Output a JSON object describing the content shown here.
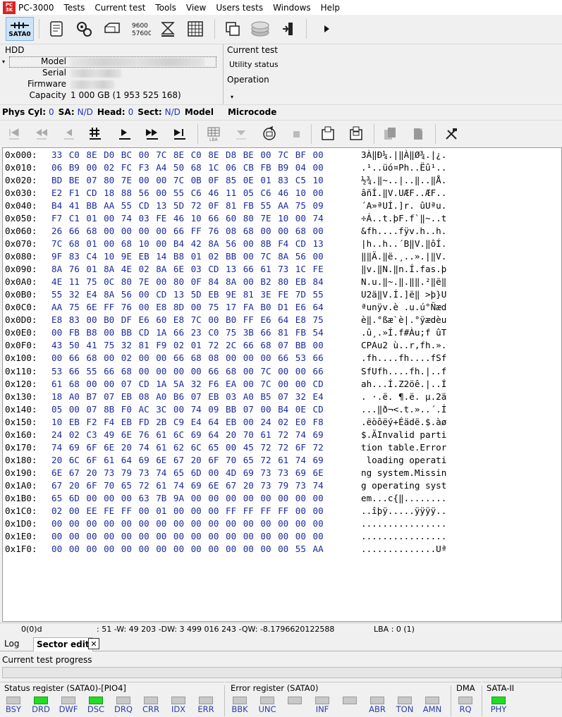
{
  "title": "PC-3000",
  "menu": [
    "Tests",
    "Current test",
    "Tools",
    "View",
    "Users tests",
    "Windows",
    "Help"
  ],
  "toolbar": {
    "sata_label": "SATA0",
    "cnt_top": "9600",
    "cnt_bottom": "57600"
  },
  "hdd": {
    "title": "HDD",
    "model_label": "Model",
    "serial_label": "Serial",
    "firmware_label": "Firmware",
    "capacity_label": "Capacity",
    "capacity": "1 000 GB (1 953 525 168)"
  },
  "current_test": {
    "label": "Current test",
    "value": "Utility status",
    "operation_label": "Operation"
  },
  "infobar": {
    "phys_cyl_label": "Phys Cyl:",
    "phys_cyl": "0",
    "sa_label": "SA:",
    "sa": "N/D",
    "head_label": "Head:",
    "head": "0",
    "sect_label": "Sect:",
    "sect": "N/D",
    "model_label": "Model",
    "microcode_label": "Microcode"
  },
  "hex_rows": [
    {
      "off": "0x000:",
      "bytes": [
        "33",
        "C0",
        "8E",
        "D0",
        "BC",
        "00",
        "7C",
        "8E",
        "C0",
        "8E",
        "D8",
        "BE",
        "00",
        "7C",
        "BF",
        "00"
      ],
      "ascii": "3À‖Ð¼.|‖À‖Ø¾.|¿."
    },
    {
      "off": "0x010:",
      "bytes": [
        "06",
        "B9",
        "00",
        "02",
        "FC",
        "F3",
        "A4",
        "50",
        "68",
        "1C",
        "06",
        "CB",
        "FB",
        "B9",
        "04",
        "00"
      ],
      "ascii": ".¹..üó¤Ph..Ëû¹.."
    },
    {
      "off": "0x020:",
      "bytes": [
        "BD",
        "BE",
        "07",
        "80",
        "7E",
        "00",
        "00",
        "7C",
        "0B",
        "0F",
        "85",
        "0E",
        "01",
        "83",
        "C5",
        "10"
      ],
      "ascii": "½¾.‖~..|..‖..‖Å."
    },
    {
      "off": "0x030:",
      "bytes": [
        "E2",
        "F1",
        "CD",
        "18",
        "88",
        "56",
        "00",
        "55",
        "C6",
        "46",
        "11",
        "05",
        "C6",
        "46",
        "10",
        "00"
      ],
      "ascii": "âñÍ.‖V.UÆF..ÆF.."
    },
    {
      "off": "0x040:",
      "bytes": [
        "B4",
        "41",
        "BB",
        "AA",
        "55",
        "CD",
        "13",
        "5D",
        "72",
        "0F",
        "81",
        "FB",
        "55",
        "AA",
        "75",
        "09"
      ],
      "ascii": "´A»ªUÍ.]r. ûUªu."
    },
    {
      "off": "0x050:",
      "bytes": [
        "F7",
        "C1",
        "01",
        "00",
        "74",
        "03",
        "FE",
        "46",
        "10",
        "66",
        "60",
        "80",
        "7E",
        "10",
        "00",
        "74"
      ],
      "ascii": "÷Á..t.þF.f`‖~..t"
    },
    {
      "off": "0x060:",
      "bytes": [
        "26",
        "66",
        "68",
        "00",
        "00",
        "00",
        "00",
        "66",
        "FF",
        "76",
        "08",
        "68",
        "00",
        "00",
        "68",
        "00"
      ],
      "ascii": "&fh....fÿv.h..h."
    },
    {
      "off": "0x070:",
      "bytes": [
        "7C",
        "68",
        "01",
        "00",
        "68",
        "10",
        "00",
        "B4",
        "42",
        "8A",
        "56",
        "00",
        "8B",
        "F4",
        "CD",
        "13"
      ],
      "ascii": "|h..h..´B‖V.‖ôÍ."
    },
    {
      "off": "0x080:",
      "bytes": [
        "9F",
        "83",
        "C4",
        "10",
        "9E",
        "EB",
        "14",
        "B8",
        "01",
        "02",
        "BB",
        "00",
        "7C",
        "8A",
        "56",
        "00"
      ],
      "ascii": "‖‖Ä.‖ë.¸..».|‖V."
    },
    {
      "off": "0x090:",
      "bytes": [
        "8A",
        "76",
        "01",
        "8A",
        "4E",
        "02",
        "8A",
        "6E",
        "03",
        "CD",
        "13",
        "66",
        "61",
        "73",
        "1C",
        "FE"
      ],
      "ascii": "‖v.‖N.‖n.Í.fas.þ"
    },
    {
      "off": "0x0A0:",
      "bytes": [
        "4E",
        "11",
        "75",
        "0C",
        "80",
        "7E",
        "00",
        "80",
        "0F",
        "84",
        "8A",
        "00",
        "B2",
        "80",
        "EB",
        "84"
      ],
      "ascii": "N.u.‖~.‖.‖‖.²‖ë‖"
    },
    {
      "off": "0x0B0:",
      "bytes": [
        "55",
        "32",
        "E4",
        "8A",
        "56",
        "00",
        "CD",
        "13",
        "5D",
        "EB",
        "9E",
        "81",
        "3E",
        "FE",
        "7D",
        "55"
      ],
      "ascii": "U2ä‖V.Í.]ë‖ >þ}U"
    },
    {
      "off": "0x0C0:",
      "bytes": [
        "AA",
        "75",
        "6E",
        "FF",
        "76",
        "00",
        "E8",
        "8D",
        "00",
        "75",
        "17",
        "FA",
        "B0",
        "D1",
        "E6",
        "64"
      ],
      "ascii": "ªunÿv.è .u.ú°Ñæd"
    },
    {
      "off": "0x0D0:",
      "bytes": [
        "E8",
        "83",
        "00",
        "B0",
        "DF",
        "E6",
        "60",
        "E8",
        "7C",
        "00",
        "B0",
        "FF",
        "E6",
        "64",
        "E8",
        "75"
      ],
      "ascii": "è‖.°ßæ`è|.°ÿædèu"
    },
    {
      "off": "0x0E0:",
      "bytes": [
        "00",
        "FB",
        "B8",
        "00",
        "BB",
        "CD",
        "1A",
        "66",
        "23",
        "C0",
        "75",
        "3B",
        "66",
        "81",
        "FB",
        "54"
      ],
      "ascii": ".û¸.»Í.f#Àu;f ûT"
    },
    {
      "off": "0x0F0:",
      "bytes": [
        "43",
        "50",
        "41",
        "75",
        "32",
        "81",
        "F9",
        "02",
        "01",
        "72",
        "2C",
        "66",
        "68",
        "07",
        "BB",
        "00"
      ],
      "ascii": "CPAu2 ù..r,fh.»."
    },
    {
      "off": "0x100:",
      "bytes": [
        "00",
        "66",
        "68",
        "00",
        "02",
        "00",
        "00",
        "66",
        "68",
        "08",
        "00",
        "00",
        "00",
        "66",
        "53",
        "66"
      ],
      "ascii": ".fh....fh....fSf"
    },
    {
      "off": "0x110:",
      "bytes": [
        "53",
        "66",
        "55",
        "66",
        "68",
        "00",
        "00",
        "00",
        "00",
        "66",
        "68",
        "00",
        "7C",
        "00",
        "00",
        "66"
      ],
      "ascii": "SfUfh....fh.|..f"
    },
    {
      "off": "0x120:",
      "bytes": [
        "61",
        "68",
        "00",
        "00",
        "07",
        "CD",
        "1A",
        "5A",
        "32",
        "F6",
        "EA",
        "00",
        "7C",
        "00",
        "00",
        "CD"
      ],
      "ascii": "ah...Í.Z2öê.|..Í"
    },
    {
      "off": "0x130:",
      "bytes": [
        "18",
        "A0",
        "B7",
        "07",
        "EB",
        "08",
        "A0",
        "B6",
        "07",
        "EB",
        "03",
        "A0",
        "B5",
        "07",
        "32",
        "E4"
      ],
      "ascii": ". ·.ë. ¶.ë. µ.2ä"
    },
    {
      "off": "0x140:",
      "bytes": [
        "05",
        "00",
        "07",
        "8B",
        "F0",
        "AC",
        "3C",
        "00",
        "74",
        "09",
        "BB",
        "07",
        "00",
        "B4",
        "0E",
        "CD"
      ],
      "ascii": "...‖ð¬<.t.»..´.Í"
    },
    {
      "off": "0x150:",
      "bytes": [
        "10",
        "EB",
        "F2",
        "F4",
        "EB",
        "FD",
        "2B",
        "C9",
        "E4",
        "64",
        "EB",
        "00",
        "24",
        "02",
        "E0",
        "F8"
      ],
      "ascii": ".ëòôëý+Éädë.$.àø"
    },
    {
      "off": "0x160:",
      "bytes": [
        "24",
        "02",
        "C3",
        "49",
        "6E",
        "76",
        "61",
        "6C",
        "69",
        "64",
        "20",
        "70",
        "61",
        "72",
        "74",
        "69"
      ],
      "ascii": "$.ÃInvalid parti"
    },
    {
      "off": "0x170:",
      "bytes": [
        "74",
        "69",
        "6F",
        "6E",
        "20",
        "74",
        "61",
        "62",
        "6C",
        "65",
        "00",
        "45",
        "72",
        "72",
        "6F",
        "72"
      ],
      "ascii": "tion table.Error"
    },
    {
      "off": "0x180:",
      "bytes": [
        "20",
        "6C",
        "6F",
        "61",
        "64",
        "69",
        "6E",
        "67",
        "20",
        "6F",
        "70",
        "65",
        "72",
        "61",
        "74",
        "69"
      ],
      "ascii": " loading operati"
    },
    {
      "off": "0x190:",
      "bytes": [
        "6E",
        "67",
        "20",
        "73",
        "79",
        "73",
        "74",
        "65",
        "6D",
        "00",
        "4D",
        "69",
        "73",
        "73",
        "69",
        "6E"
      ],
      "ascii": "ng system.Missin"
    },
    {
      "off": "0x1A0:",
      "bytes": [
        "67",
        "20",
        "6F",
        "70",
        "65",
        "72",
        "61",
        "74",
        "69",
        "6E",
        "67",
        "20",
        "73",
        "79",
        "73",
        "74"
      ],
      "ascii": "g operating syst"
    },
    {
      "off": "0x1B0:",
      "bytes": [
        "65",
        "6D",
        "00",
        "00",
        "00",
        "63",
        "7B",
        "9A",
        "00",
        "00",
        "00",
        "00",
        "00",
        "00",
        "00",
        "00"
      ],
      "ascii": "em...c{‖........"
    },
    {
      "off": "0x1C0:",
      "bytes": [
        "02",
        "00",
        "EE",
        "FE",
        "FF",
        "00",
        "01",
        "00",
        "00",
        "00",
        "FF",
        "FF",
        "FF",
        "FF",
        "00",
        "00"
      ],
      "ascii": "..îþÿ.....ÿÿÿÿ.."
    },
    {
      "off": "0x1D0:",
      "bytes": [
        "00",
        "00",
        "00",
        "00",
        "00",
        "00",
        "00",
        "00",
        "00",
        "00",
        "00",
        "00",
        "00",
        "00",
        "00",
        "00"
      ],
      "ascii": "................"
    },
    {
      "off": "0x1E0:",
      "bytes": [
        "00",
        "00",
        "00",
        "00",
        "00",
        "00",
        "00",
        "00",
        "00",
        "00",
        "00",
        "00",
        "00",
        "00",
        "00",
        "00"
      ],
      "ascii": "................"
    },
    {
      "off": "0x1F0:",
      "bytes": [
        "00",
        "00",
        "00",
        "00",
        "00",
        "00",
        "00",
        "00",
        "00",
        "00",
        "00",
        "00",
        "00",
        "00",
        "55",
        "AA"
      ],
      "ascii": "..............Uª"
    }
  ],
  "statusbar": {
    "pos": "0(0)d",
    "values": ": 51 -W: 49 203 -DW: 3 499 016 243 -QW: -8.1796620122588",
    "lba": "LBA : 0 (1)"
  },
  "tabs": {
    "log": "Log",
    "sector_edit": "Sector edit",
    "close": "✕"
  },
  "progress_label": "Current test progress",
  "status_register": {
    "title": "Status register (SATA0)-[PIO4]",
    "leds": [
      {
        "name": "BSY",
        "on": false
      },
      {
        "name": "DRD",
        "on": true
      },
      {
        "name": "DWF",
        "on": false
      },
      {
        "name": "DSC",
        "on": true
      },
      {
        "name": "DRQ",
        "on": false
      },
      {
        "name": "CRR",
        "on": false
      },
      {
        "name": "IDX",
        "on": false
      },
      {
        "name": "ERR",
        "on": false
      }
    ]
  },
  "error_register": {
    "title": "Error register (SATA0)",
    "leds": [
      {
        "name": "BBK",
        "on": false
      },
      {
        "name": "UNC",
        "on": false
      },
      {
        "name": "",
        "on": false
      },
      {
        "name": "INF",
        "on": false
      },
      {
        "name": "",
        "on": false
      },
      {
        "name": "ABR",
        "on": false
      },
      {
        "name": "TON",
        "on": false
      },
      {
        "name": "AMN",
        "on": false
      }
    ]
  },
  "dma": {
    "title": "DMA",
    "led": {
      "name": "RQ",
      "on": false
    }
  },
  "sata": {
    "title": "SATA-II",
    "led": {
      "name": "PHY",
      "on": true
    }
  }
}
